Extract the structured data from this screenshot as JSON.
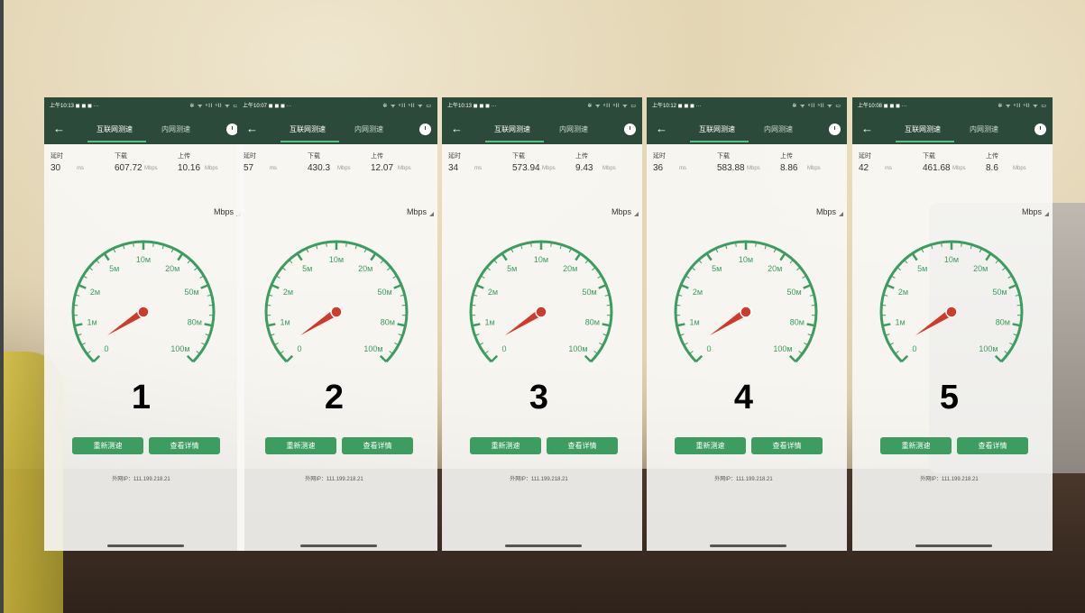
{
  "status": {
    "icons": "✲ ᯤ ⁿll ⁿll ᯤ ▭"
  },
  "tabs": {
    "internet": "互联网测速",
    "intranet": "内网测速"
  },
  "labels": {
    "latency": "延时",
    "download": "下载",
    "upload": "上传",
    "ms": "ms",
    "mbps": "Mbps"
  },
  "unit_selector": "Mbps",
  "gauge_ticks": [
    "0",
    "1м",
    "2м",
    "5м",
    "10м",
    "20м",
    "50м",
    "80м",
    "100м"
  ],
  "buttons": {
    "retest": "重新测速",
    "details": "查看详情"
  },
  "external_ip": "外网IP：111.199.218.21",
  "colors": {
    "appbar": "#2c4a3a",
    "gauge": "#3d9c5f",
    "needle": "#d03a2c",
    "button": "#3d9c5f"
  },
  "tests": [
    {
      "time": "上午10:13 ◼ ◼ ◼ ···",
      "latency": "30",
      "download": "607.72",
      "upload": "10.16",
      "number": "1"
    },
    {
      "time": "上午10:07 ◼ ◼ ◼ ···",
      "latency": "57",
      "download": "430.3",
      "upload": "12.07",
      "number": "2"
    },
    {
      "time": "上午10:13 ◼ ◼ ◼ ···",
      "latency": "34",
      "download": "573.94",
      "upload": "9.43",
      "number": "3"
    },
    {
      "time": "上午10:12 ◼ ◼ ◼ ···",
      "latency": "36",
      "download": "583.88",
      "upload": "8.86",
      "number": "4"
    },
    {
      "time": "上午10:08 ◼ ◼ ◼ ···",
      "latency": "42",
      "download": "461.68",
      "upload": "8.6",
      "number": "5"
    }
  ]
}
